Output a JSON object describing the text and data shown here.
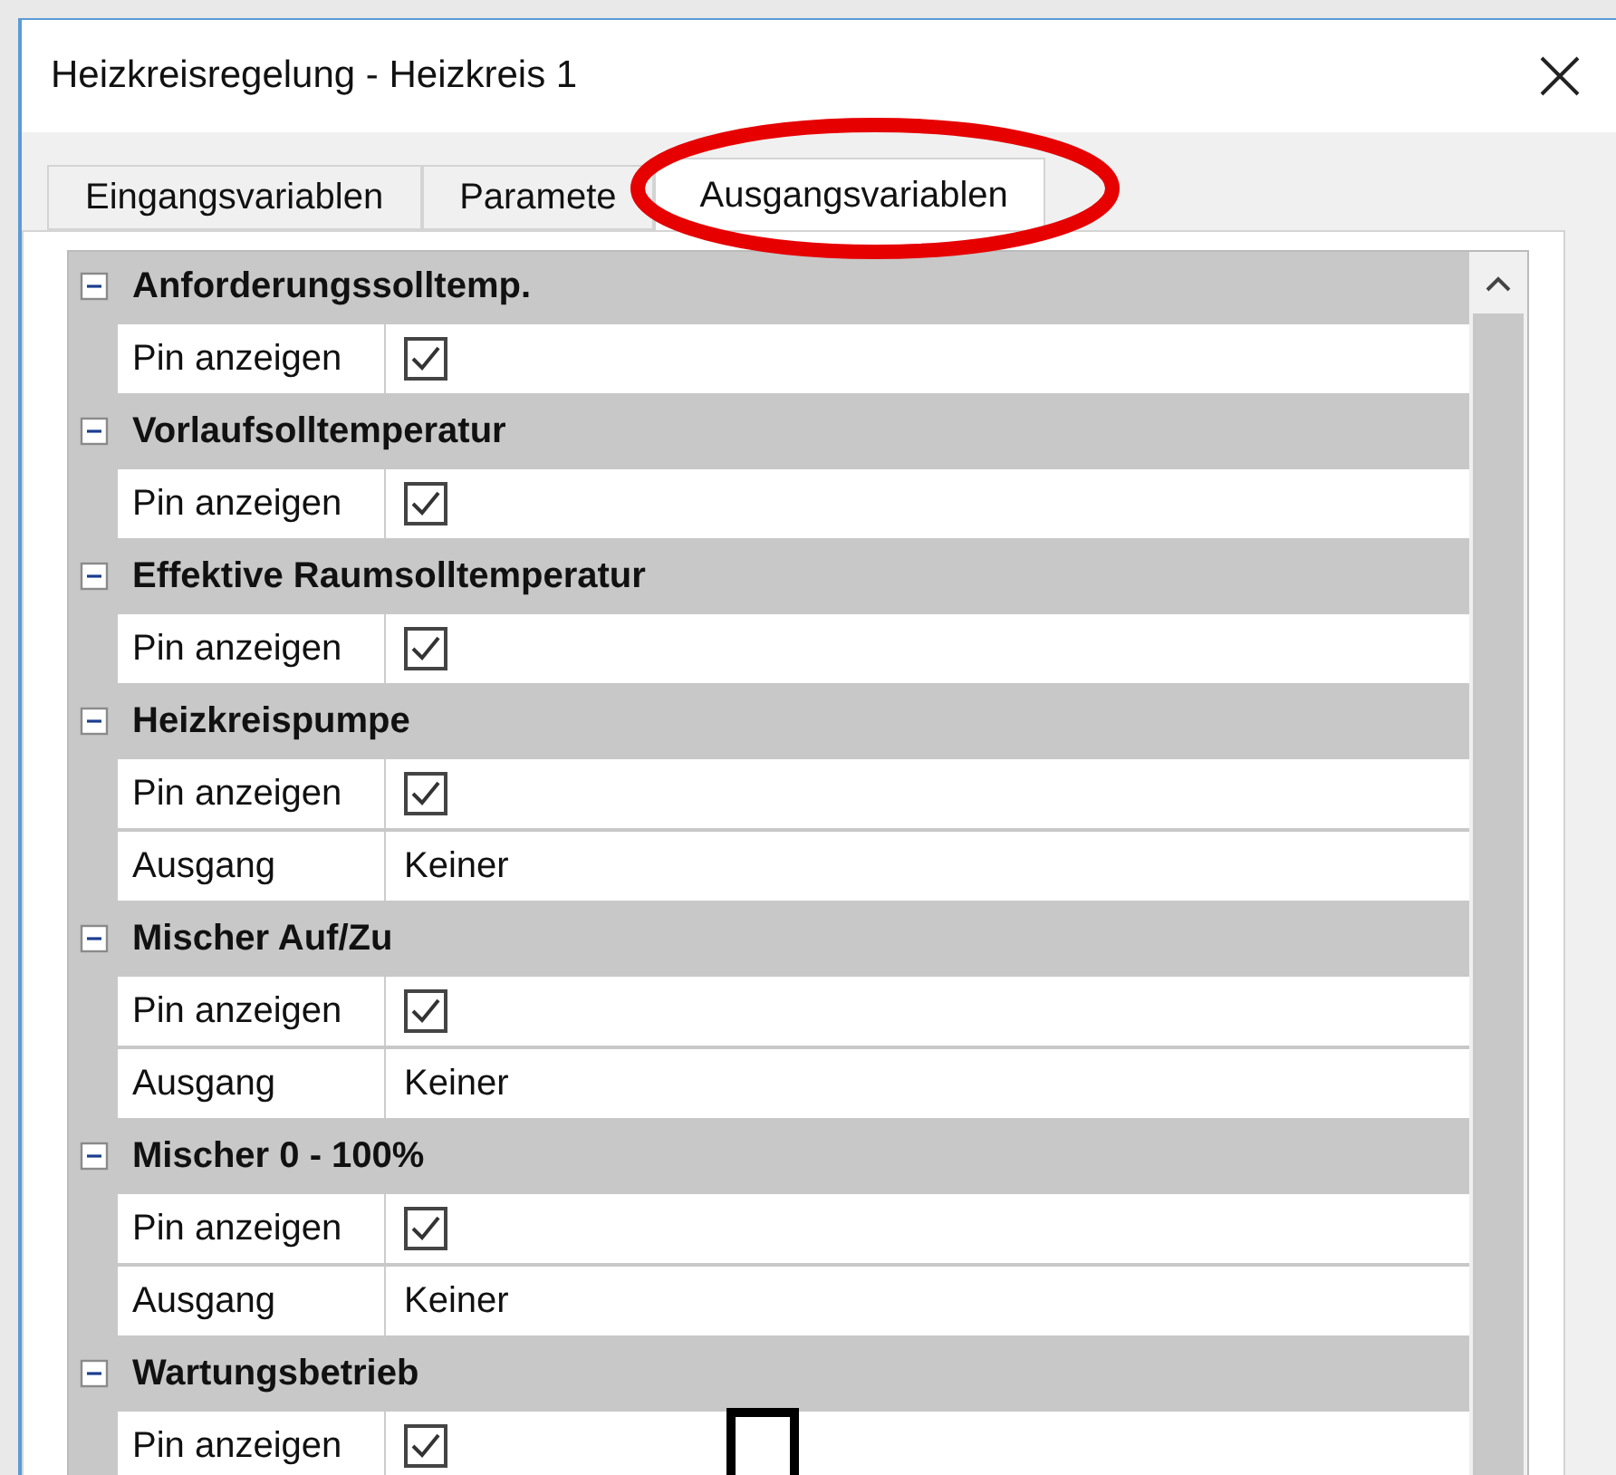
{
  "window": {
    "title": "Heizkreisregelung - Heizkreis 1"
  },
  "tabs": [
    {
      "label": "Eingangsvariablen",
      "selected": false
    },
    {
      "label": "Paramete",
      "selected": false
    },
    {
      "label": "Ausgangsvariablen",
      "selected": true
    }
  ],
  "groups": [
    {
      "name": "Anforderungssolltemp.",
      "expanded": true,
      "properties": [
        {
          "label": "Pin anzeigen",
          "kind": "checkbox",
          "checked": true
        }
      ]
    },
    {
      "name": "Vorlaufsolltemperatur",
      "expanded": true,
      "properties": [
        {
          "label": "Pin anzeigen",
          "kind": "checkbox",
          "checked": true
        }
      ]
    },
    {
      "name": "Effektive Raumsolltemperatur",
      "expanded": true,
      "properties": [
        {
          "label": "Pin anzeigen",
          "kind": "checkbox",
          "checked": true
        }
      ]
    },
    {
      "name": "Heizkreispumpe",
      "expanded": true,
      "properties": [
        {
          "label": "Pin anzeigen",
          "kind": "checkbox",
          "checked": true
        },
        {
          "label": "Ausgang",
          "kind": "text",
          "value": "Keiner"
        }
      ]
    },
    {
      "name": "Mischer Auf/Zu",
      "expanded": true,
      "properties": [
        {
          "label": "Pin anzeigen",
          "kind": "checkbox",
          "checked": true
        },
        {
          "label": "Ausgang",
          "kind": "text",
          "value": "Keiner"
        }
      ]
    },
    {
      "name": "Mischer 0 - 100%",
      "expanded": true,
      "properties": [
        {
          "label": "Pin anzeigen",
          "kind": "checkbox",
          "checked": true
        },
        {
          "label": "Ausgang",
          "kind": "text",
          "value": "Keiner"
        }
      ]
    },
    {
      "name": "Wartungsbetrieb",
      "expanded": true,
      "properties": [
        {
          "label": "Pin anzeigen",
          "kind": "checkbox",
          "checked": true
        }
      ]
    }
  ]
}
